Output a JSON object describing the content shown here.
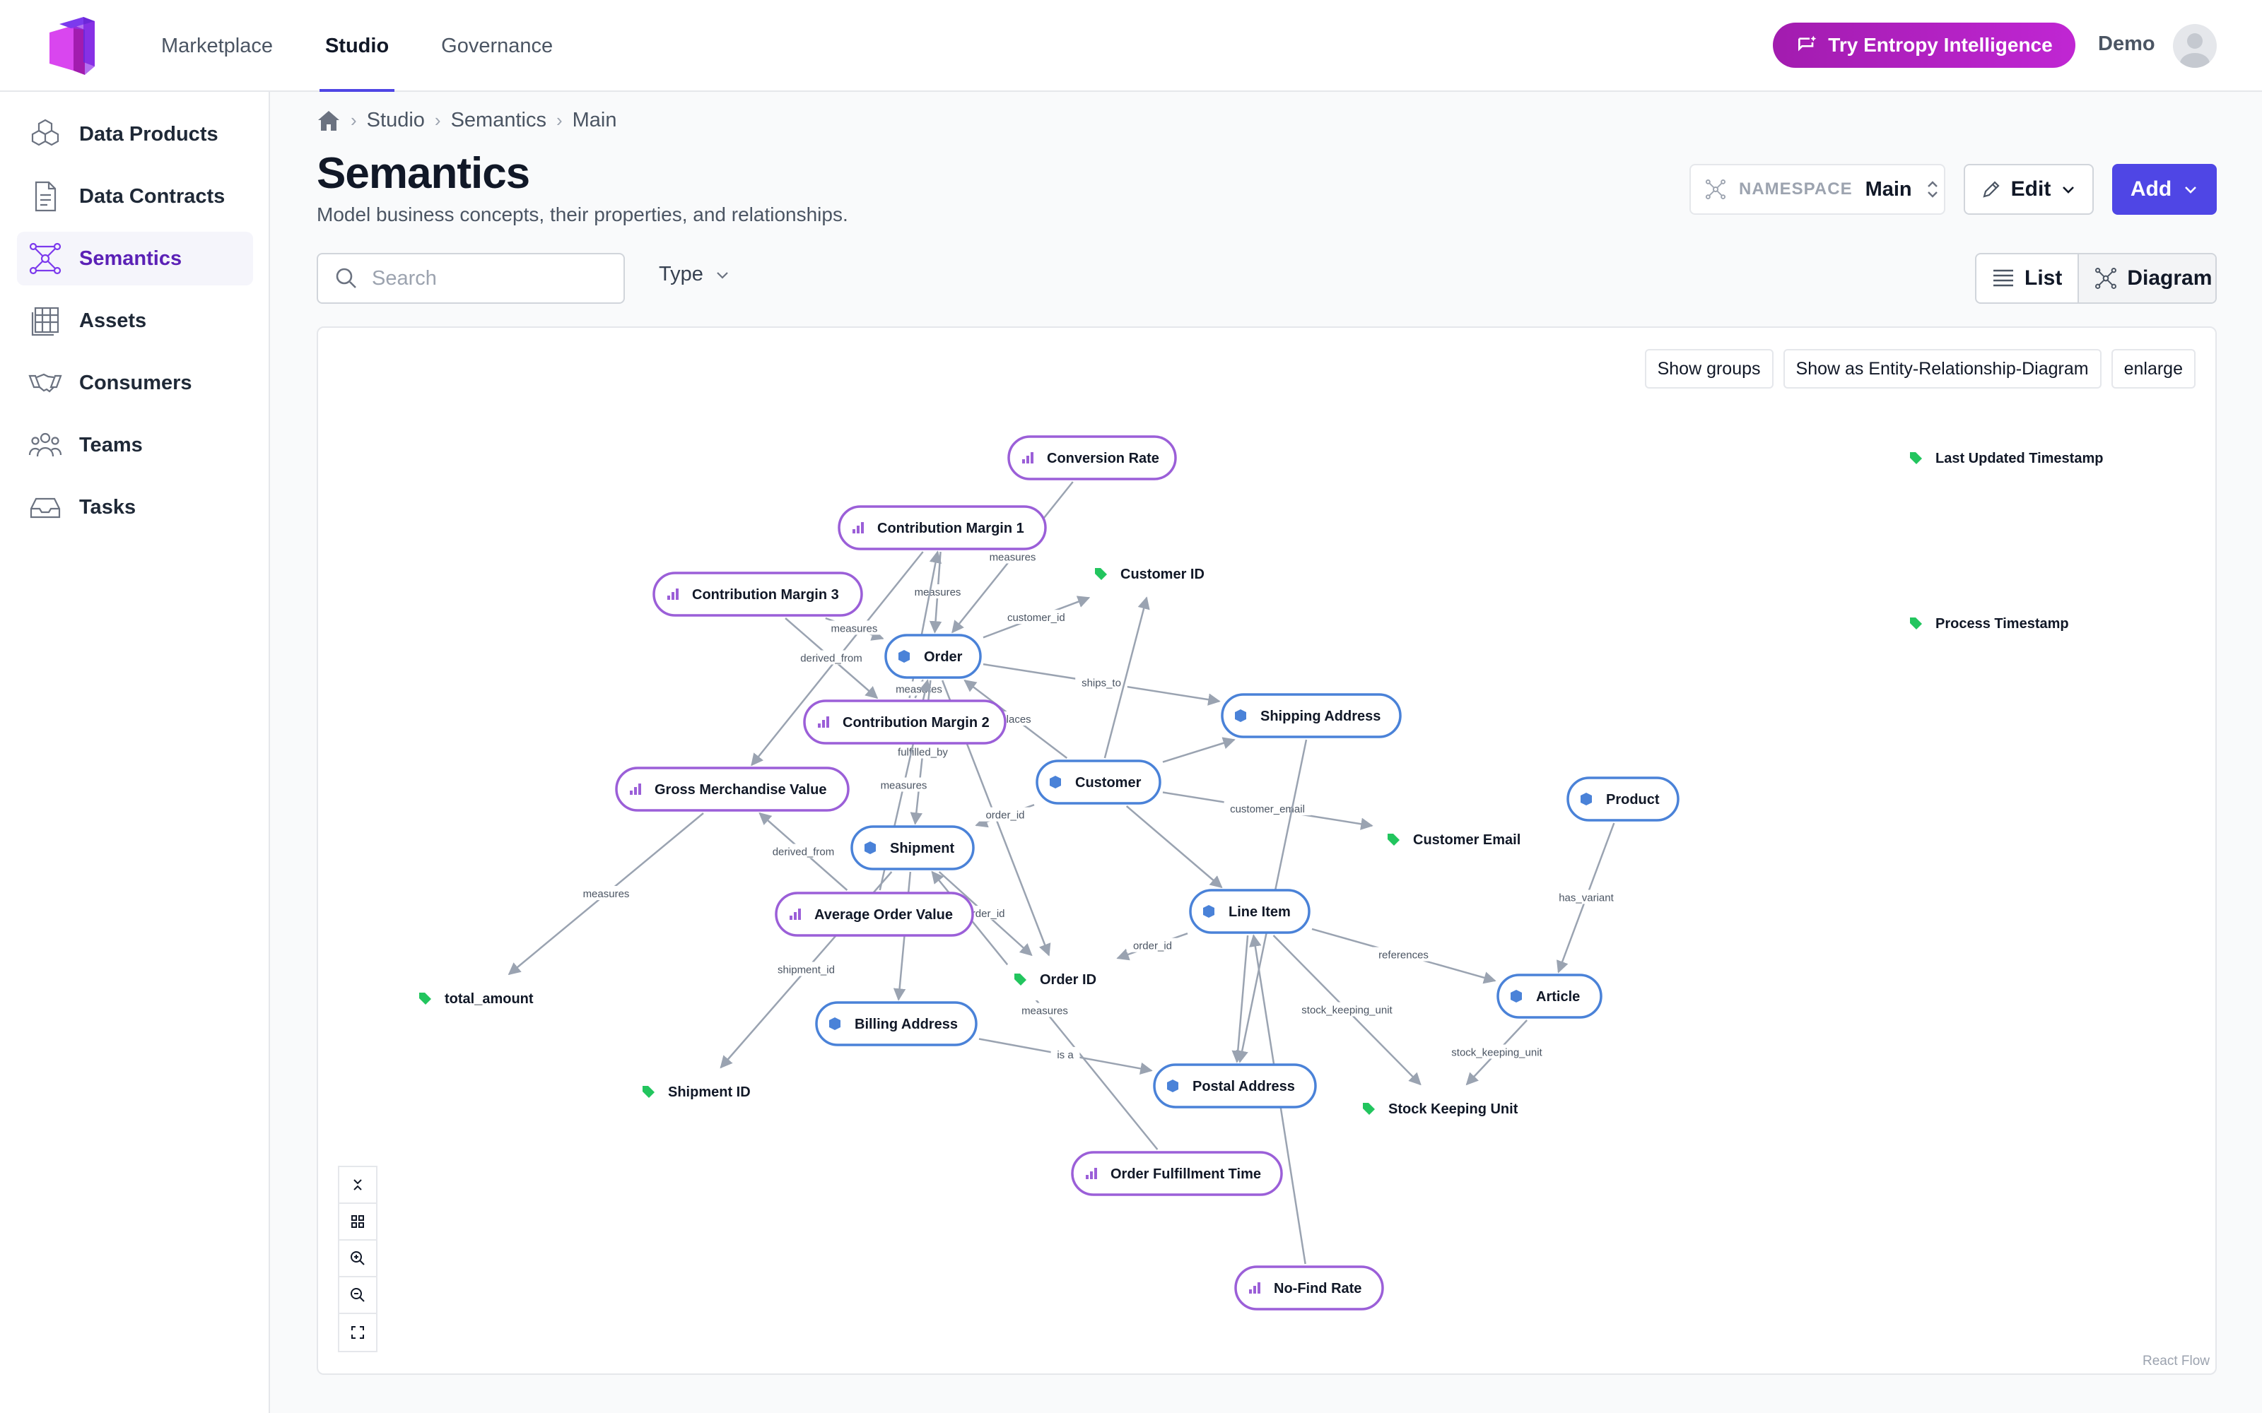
{
  "topnav": {
    "tabs": [
      {
        "label": "Marketplace",
        "active": false
      },
      {
        "label": "Studio",
        "active": true
      },
      {
        "label": "Governance",
        "active": false
      }
    ],
    "ai_button": "Try Entropy Intelligence",
    "user_name": "Demo"
  },
  "sidebar": {
    "items": [
      {
        "label": "Data Products",
        "icon": "cubes-icon",
        "active": false
      },
      {
        "label": "Data Contracts",
        "icon": "document-icon",
        "active": false
      },
      {
        "label": "Semantics",
        "icon": "network-icon",
        "active": true
      },
      {
        "label": "Assets",
        "icon": "table-icon",
        "active": false
      },
      {
        "label": "Consumers",
        "icon": "handshake-icon",
        "active": false
      },
      {
        "label": "Teams",
        "icon": "users-icon",
        "active": false
      },
      {
        "label": "Tasks",
        "icon": "inbox-icon",
        "active": false
      }
    ]
  },
  "breadcrumb": [
    "Studio",
    "Semantics",
    "Main"
  ],
  "page": {
    "title": "Semantics",
    "subtitle": "Model business concepts, their properties, and relationships."
  },
  "namespace": {
    "label": "NAMESPACE",
    "value": "Main"
  },
  "actions": {
    "edit": "Edit",
    "add": "Add"
  },
  "search": {
    "placeholder": "Search",
    "value": ""
  },
  "filter": {
    "type_label": "Type"
  },
  "view": {
    "list": "List",
    "diagram": "Diagram",
    "selected": "Diagram"
  },
  "diagram": {
    "buttons": [
      "Show groups",
      "Show as Entity-Relationship-Diagram",
      "enlarge"
    ],
    "attribution": "React Flow",
    "colors": {
      "metric": "#9b5fd8",
      "entity": "#4a82d8",
      "attribute": "#22c55e"
    },
    "nodes": [
      {
        "id": "conversion_rate",
        "label": "Conversion Rate",
        "kind": "metric"
      },
      {
        "id": "cm1",
        "label": "Contribution Margin 1",
        "kind": "metric"
      },
      {
        "id": "cm3",
        "label": "Contribution Margin 3",
        "kind": "metric"
      },
      {
        "id": "cm2",
        "label": "Contribution Margin 2",
        "kind": "metric"
      },
      {
        "id": "gmv",
        "label": "Gross Merchandise Value",
        "kind": "metric"
      },
      {
        "id": "aov",
        "label": "Average Order Value",
        "kind": "metric"
      },
      {
        "id": "oft",
        "label": "Order Fulfillment Time",
        "kind": "metric"
      },
      {
        "id": "nofind",
        "label": "No-Find Rate",
        "kind": "metric"
      },
      {
        "id": "order",
        "label": "Order",
        "kind": "entity"
      },
      {
        "id": "customer",
        "label": "Customer",
        "kind": "entity"
      },
      {
        "id": "shipaddr",
        "label": "Shipping Address",
        "kind": "entity"
      },
      {
        "id": "shipment",
        "label": "Shipment",
        "kind": "entity"
      },
      {
        "id": "lineitem",
        "label": "Line Item",
        "kind": "entity"
      },
      {
        "id": "product",
        "label": "Product",
        "kind": "entity"
      },
      {
        "id": "article",
        "label": "Article",
        "kind": "entity"
      },
      {
        "id": "billaddr",
        "label": "Billing Address",
        "kind": "entity"
      },
      {
        "id": "postaddr",
        "label": "Postal Address",
        "kind": "entity"
      },
      {
        "id": "customer_id",
        "label": "Customer ID",
        "kind": "attribute"
      },
      {
        "id": "customer_email",
        "label": "Customer Email",
        "kind": "attribute"
      },
      {
        "id": "order_id",
        "label": "Order ID",
        "kind": "attribute"
      },
      {
        "id": "total_amount",
        "label": "total_amount",
        "kind": "attribute"
      },
      {
        "id": "shipment_id",
        "label": "Shipment ID",
        "kind": "attribute"
      },
      {
        "id": "sku",
        "label": "Stock Keeping Unit",
        "kind": "attribute"
      },
      {
        "id": "last_updated",
        "label": "Last Updated Timestamp",
        "kind": "attribute"
      },
      {
        "id": "process_ts",
        "label": "Process Timestamp",
        "kind": "attribute"
      }
    ],
    "edges": [
      {
        "from": "conversion_rate",
        "to": "order",
        "label": "measures"
      },
      {
        "from": "cm1",
        "to": "order",
        "label": "measures"
      },
      {
        "from": "cm1",
        "to": "gmv",
        "label": ""
      },
      {
        "from": "cm3",
        "to": "order",
        "label": "measures"
      },
      {
        "from": "cm3",
        "to": "cm2",
        "label": "derived_from"
      },
      {
        "from": "cm2",
        "to": "cm1",
        "label": ""
      },
      {
        "from": "cm2",
        "to": "order",
        "label": "measures"
      },
      {
        "from": "order",
        "to": "customer_id",
        "label": "customer_id"
      },
      {
        "from": "order",
        "to": "shipaddr",
        "label": "ships_to"
      },
      {
        "from": "order",
        "to": "shipment",
        "label": "fulfilled_by"
      },
      {
        "from": "order",
        "to": "order_id",
        "label": ""
      },
      {
        "from": "customer",
        "to": "order",
        "label": "places"
      },
      {
        "from": "customer",
        "to": "customer_id",
        "label": ""
      },
      {
        "from": "customer",
        "to": "shipaddr",
        "label": ""
      },
      {
        "from": "customer",
        "to": "customer_email",
        "label": "customer_email"
      },
      {
        "from": "customer",
        "to": "lineitem",
        "label": ""
      },
      {
        "from": "customer",
        "to": "shipment",
        "label": "order_id"
      },
      {
        "from": "aov",
        "to": "order",
        "label": "measures"
      },
      {
        "from": "aov",
        "to": "gmv",
        "label": "derived_from"
      },
      {
        "from": "gmv",
        "to": "total_amount",
        "label": "measures"
      },
      {
        "from": "shipment",
        "to": "order_id",
        "label": "order_id"
      },
      {
        "from": "shipment",
        "to": "shipment_id",
        "label": "shipment_id"
      },
      {
        "from": "shipment",
        "to": "billaddr",
        "label": ""
      },
      {
        "from": "oft",
        "to": "shipment",
        "label": "measures"
      },
      {
        "from": "lineitem",
        "to": "order_id",
        "label": "order_id"
      },
      {
        "from": "lineitem",
        "to": "article",
        "label": "references"
      },
      {
        "from": "lineitem",
        "to": "sku",
        "label": "stock_keeping_unit"
      },
      {
        "from": "lineitem",
        "to": "postaddr",
        "label": ""
      },
      {
        "from": "shipaddr",
        "to": "postaddr",
        "label": ""
      },
      {
        "from": "nofind",
        "to": "lineitem",
        "label": ""
      },
      {
        "from": "billaddr",
        "to": "postaddr",
        "label": "is a"
      },
      {
        "from": "product",
        "to": "article",
        "label": "has_variant"
      },
      {
        "from": "article",
        "to": "sku",
        "label": "stock_keeping_unit"
      }
    ]
  }
}
